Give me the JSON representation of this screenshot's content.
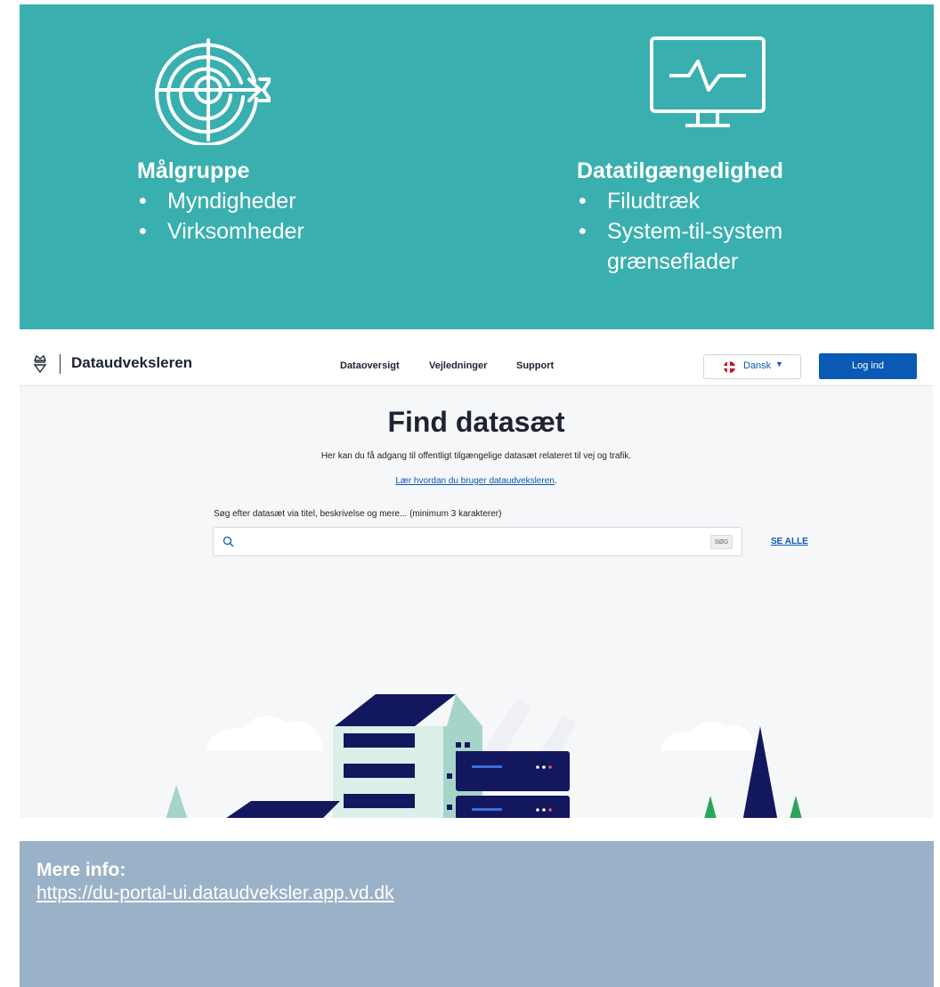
{
  "colors": {
    "teal": "#3aafaf",
    "grey_panel": "#9bb1c7",
    "primary_blue": "#0a59b4",
    "navy": "#12175e"
  },
  "audience": {
    "heading": "Målgruppe",
    "items": [
      "Myndigheder",
      "Virksomheder"
    ],
    "icon": "target-arrow-icon"
  },
  "availability": {
    "heading": "Datatilgængelighed",
    "items": [
      "Filudtræk",
      "System-til-system grænseflader"
    ],
    "icon": "monitor-pulse-icon"
  },
  "app": {
    "brand": "Dataudveksleren",
    "nav": [
      "Dataoversigt",
      "Vejledninger",
      "Support"
    ],
    "language": "Dansk",
    "login": "Log ind",
    "title": "Find datasæt",
    "description": "Her kan du få adgang til offentligt tilgængelige datasæt relateret til vej og trafik.",
    "learn_link": "Lær hvordan du bruger dataudveksleren",
    "learn_suffix": ".",
    "search_label": "Søg efter datasæt via titel, beskrivelse og mere... (minimum 3 karakterer)",
    "search_value": "",
    "search_button": "SØG",
    "see_all": "SE ALLE"
  },
  "more_info": {
    "label": "Mere info:",
    "url": "https://du-portal-ui.dataudveksler.app.vd.dk"
  }
}
